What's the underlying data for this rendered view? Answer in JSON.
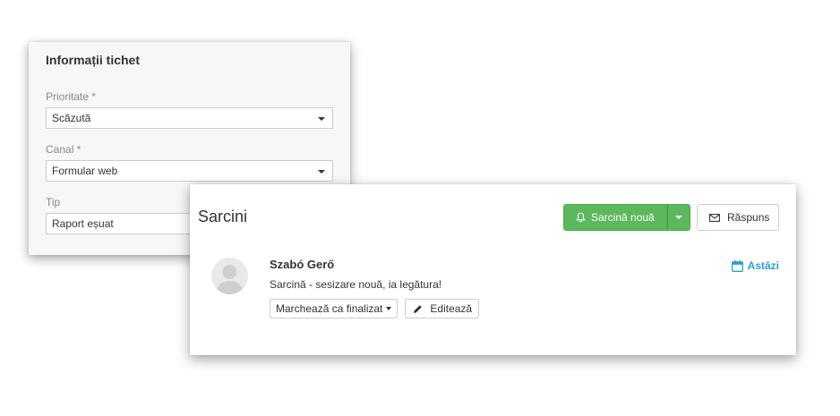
{
  "ticket_info": {
    "title": "Informații tichet",
    "priority": {
      "label": "Prioritate *",
      "value": "Scăzută"
    },
    "channel": {
      "label": "Canal *",
      "value": "Formular web"
    },
    "type": {
      "label": "Tip",
      "value": "Raport eșuat"
    }
  },
  "tasks": {
    "title": "Sarcini",
    "new_task_label": "Sarcină nouă",
    "reply_label": "Răspuns",
    "items": [
      {
        "author": "Szabó Gerő",
        "description": "Sarcină - sesizare nouă, ia legătura!",
        "mark_done_label": "Marchează ca finalizat",
        "edit_label": "Editează",
        "due": "Astăzi"
      }
    ]
  },
  "colors": {
    "accent_green": "#5cb85c",
    "link_blue": "#2a9fd6"
  },
  "icons": [
    "bell-icon",
    "envelope-icon",
    "pencil-icon",
    "calendar-icon",
    "user-avatar-icon",
    "chevron-down-icon"
  ]
}
